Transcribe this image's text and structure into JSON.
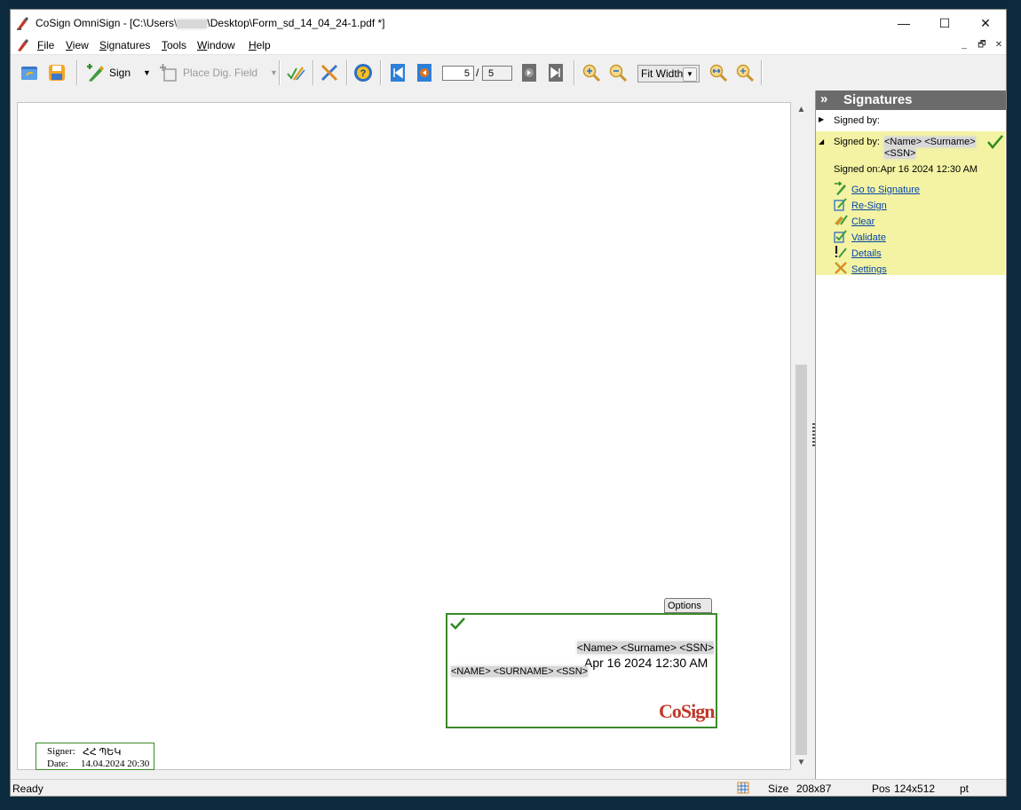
{
  "window": {
    "title": "CoSign OmniSign - [C:\\Users\\",
    "title_suffix": "\\Desktop\\Form_sd_14_04_24-1.pdf *]",
    "controls": {
      "minimize": "—",
      "maximize": "☐",
      "close": "✕"
    }
  },
  "menu": {
    "items": [
      {
        "first": "F",
        "rest": "ile"
      },
      {
        "first": "V",
        "rest": "iew"
      },
      {
        "first": "S",
        "rest": "ignatures"
      },
      {
        "first": "T",
        "rest": "ools"
      },
      {
        "first": "W",
        "rest": "indow"
      },
      {
        "first": "H",
        "rest": "elp"
      }
    ],
    "mdi": {
      "minimize": "_",
      "restore": "🗗",
      "close": "✕"
    }
  },
  "toolbar": {
    "sign_label": "Sign",
    "place_field_label": "Place Dig. Field",
    "page_current": "5",
    "page_separator": "/",
    "page_total": "5",
    "zoom_value": "Fit Width"
  },
  "document": {
    "options_label": "Options",
    "signature": {
      "name_line": "<Name> <Surname> <SSN>",
      "date_line": "Apr 16 2024 12:30 AM",
      "caps_line": "<NAME> <SURNAME> <SSN>",
      "logo_text_1": "Co",
      "logo_text_2": "Sign"
    },
    "small_sig": {
      "signer_label": "Signer:",
      "signer_value": "ՀՀ ՊԵԿ",
      "date_label": "Date:",
      "date_value": "14.04.2024 20:30"
    }
  },
  "panel": {
    "title": "Signatures",
    "signed_by_empty": "Signed by:",
    "signed_by_label": "Signed by:",
    "signed_by_name": "<Name> <Surname>",
    "signed_by_ssn": "<SSN>",
    "signed_on": "Signed on:Apr 16 2024 12:30 AM",
    "links": [
      "Go to Signature",
      "Re-Sign",
      "Clear",
      "Validate",
      "Details",
      "Settings"
    ]
  },
  "status": {
    "text": "Ready",
    "size_label": "Size",
    "size_value": "208x87",
    "pos_label": "Pos",
    "pos_value": "124x512",
    "unit": "pt"
  },
  "colors": {
    "valid_green": "#2f8a1f",
    "highlight": "#f3f3a3",
    "link": "#0645ad"
  }
}
